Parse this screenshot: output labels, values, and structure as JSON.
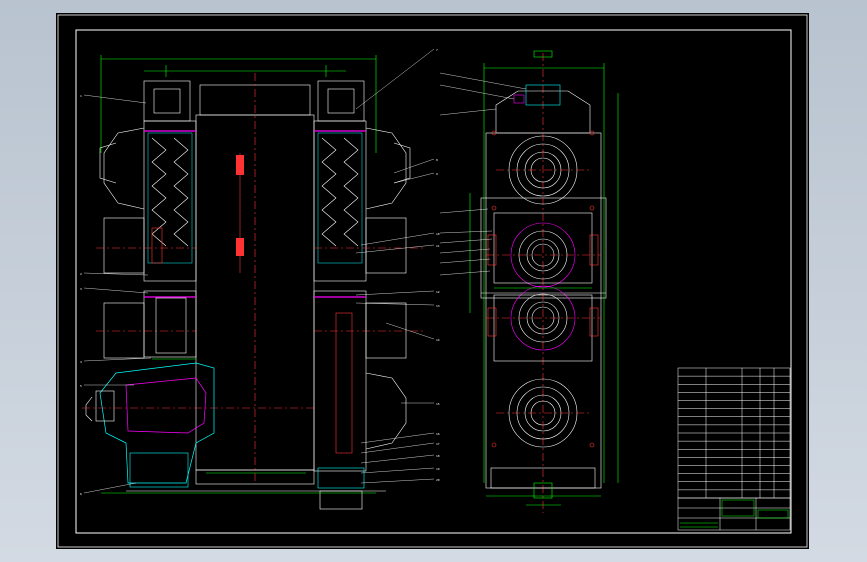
{
  "colors": {
    "background": "#000000",
    "frame": "#ffffff",
    "outline": "#ffffff",
    "centerline": "#ff3333",
    "dimension": "#00ff00",
    "hatch": "#00ffff",
    "highlight": "#ff00ff",
    "leader": "#ffffff",
    "viewport": "#bcc6d2"
  },
  "notes": {
    "title": "",
    "lines": []
  },
  "title_block": {
    "rows": 16,
    "name_cell": "",
    "drawing_no": ""
  },
  "views": [
    {
      "name": "section-view",
      "description": ""
    },
    {
      "name": "end-view",
      "description": ""
    }
  ]
}
